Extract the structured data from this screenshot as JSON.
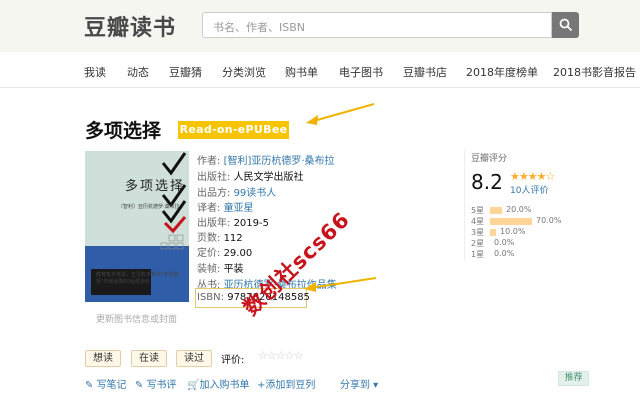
{
  "header": {
    "logo": "豆瓣读书",
    "search_placeholder": "书名、作者、ISBN"
  },
  "nav": [
    "我读",
    "动态",
    "豆瓣猜",
    "分类浏览",
    "购书单",
    "电子图书",
    "豆瓣书店",
    "2018年度榜单",
    "2018书影音报告"
  ],
  "book": {
    "title": "多项选择",
    "badge": "Read-on-ePUBee",
    "cover_title": "多项选择",
    "cover_subtitle": "〔智利〕亚历杭德罗·桑布拉",
    "cover_note": "教育有多荒谬，生活有多荒谬\"多项选择\"开启另类80后成长纪",
    "cover_caption": "更新图书信息或封面",
    "info": {
      "author_label": "作者:",
      "author": "[智利]亚历杭德罗·桑布拉",
      "publisher_label": "出版社:",
      "publisher": "人民文学出版社",
      "producer_label": "出品方:",
      "producer": "99读书人",
      "translator_label": "译者:",
      "translator": "童亚星",
      "year_label": "出版年:",
      "year": "2019-5",
      "pages_label": "页数:",
      "pages": "112",
      "price_label": "定价:",
      "price": "29.00",
      "binding_label": "装帧:",
      "binding": "平装",
      "series_label": "丛书:",
      "series": "亚历杭德罗·桑布拉作品集",
      "isbn_label": "ISBN:",
      "isbn": "9787020148585"
    }
  },
  "rating": {
    "label": "豆瓣评分",
    "score": "8.2",
    "stars": "★★★★☆",
    "count": "10人评价",
    "rows": [
      {
        "label": "5星",
        "pct": "20.0%",
        "value": 20.0
      },
      {
        "label": "4星",
        "pct": "70.0%",
        "value": 70.0
      },
      {
        "label": "3星",
        "pct": "10.0%",
        "value": 10.0
      },
      {
        "label": "2星",
        "pct": "0.0%",
        "value": 0.0
      },
      {
        "label": "1星",
        "pct": "0.0%",
        "value": 0.0
      }
    ]
  },
  "buttons": {
    "want": "想读",
    "reading": "在读",
    "read": "读过",
    "rate_label": "评价:",
    "rate_stars": "☆☆☆☆☆"
  },
  "actions": {
    "note": "写笔记",
    "review": "写书评",
    "cart": "加入购书单",
    "doulist": "添加到豆列",
    "share": "分享到",
    "recommend": "推荐"
  },
  "watermark": "数创社scs66",
  "colors": {
    "link": "#3377aa",
    "badge": "#f6c400",
    "star": "#ffac2d",
    "watermark": "#c8121c"
  }
}
